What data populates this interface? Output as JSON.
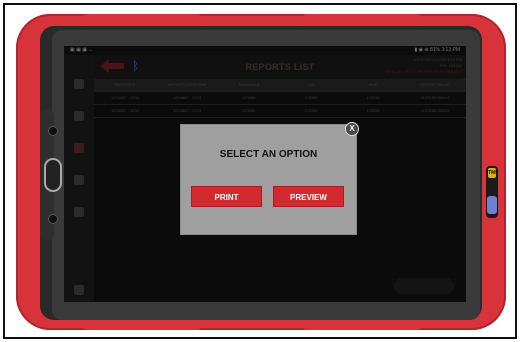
{
  "statusbar": {
    "left": "▣ ▣ ▣ ...",
    "right": "▮ ◉ ⊕ 81% 3:13 PM"
  },
  "header": {
    "title": "REPORTS LIST",
    "info_line1": "DATE: 03/01/2018 3:13 PM",
    "info_line2": "PIN: 123456",
    "info_line3": "VEHICLE: 2018 CHEVROLET SILVERADO"
  },
  "table": {
    "headers": [
      "REPORT #",
      "REPORT DATE/TIME",
      "MODULE #",
      "VIN",
      "RMP",
      "REPORT NAME"
    ],
    "rows": [
      [
        "1234567 - 1234",
        "1234567 - 1234",
        "123456",
        "123456",
        "123456",
        "0123456789012"
      ],
      [
        "1234567 - 1234",
        "1234567 - 1234",
        "123456",
        "123456",
        "123456",
        "0123456789012"
      ]
    ]
  },
  "modal": {
    "title": "SELECT AN OPTION",
    "print_label": "PRINT",
    "preview_label": "PREVIEW",
    "close_label": "X"
  },
  "stylus": {
    "brand": "TMF"
  },
  "colors": {
    "case_red": "#d8323a",
    "button_red": "#d32a2f",
    "modal_gray": "#9f9f9f",
    "screen_bg": "#0b0b0b"
  }
}
